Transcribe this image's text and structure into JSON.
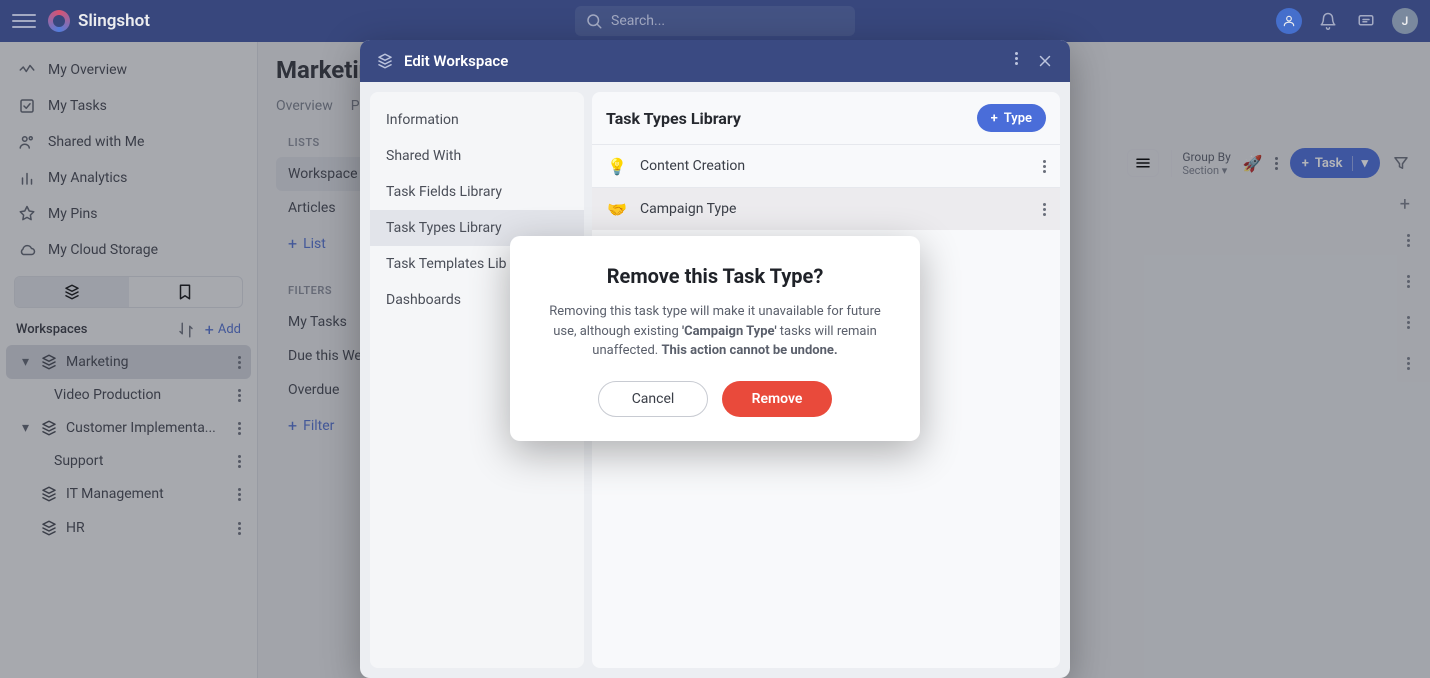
{
  "app": {
    "name": "Slingshot"
  },
  "search": {
    "placeholder": "Search..."
  },
  "top_avatar": "J",
  "sidebar": {
    "items": [
      {
        "label": "My Overview"
      },
      {
        "label": "My Tasks"
      },
      {
        "label": "Shared with Me"
      },
      {
        "label": "My Analytics"
      },
      {
        "label": "My Pins"
      },
      {
        "label": "My Cloud Storage"
      }
    ],
    "workspaces_label": "Workspaces",
    "add_label": "Add",
    "workspaces": [
      {
        "label": "Marketing",
        "selected": true,
        "expandable": true
      },
      {
        "label": "Video Production",
        "sub": true
      },
      {
        "label": "Customer Implementa...",
        "expandable": true
      },
      {
        "label": "Support",
        "sub": true
      },
      {
        "label": "IT Management"
      },
      {
        "label": "HR"
      }
    ]
  },
  "content": {
    "title": "Marketing",
    "tabs": [
      "Overview",
      "P"
    ],
    "lists_label": "LISTS",
    "lists": [
      "Workspace T",
      "Articles"
    ],
    "add_list": "List",
    "filters_label": "FILTERS",
    "filters": [
      "My Tasks",
      "Due this We",
      "Overdue"
    ],
    "add_filter": "Filter"
  },
  "toolbar": {
    "groupby_label": "Group By",
    "groupby_value": "Section",
    "task_label": "Task"
  },
  "modal": {
    "title": "Edit Workspace",
    "sidebar": [
      "Information",
      "Shared With",
      "Task Fields Library",
      "Task Types Library",
      "Task Templates Lib",
      "Dashboards"
    ],
    "selected_index": 3,
    "main_title": "Task Types Library",
    "type_btn": "Type",
    "task_types": [
      {
        "icon": "💡",
        "label": "Content Creation"
      },
      {
        "icon": "🤝",
        "label": "Campaign Type"
      }
    ]
  },
  "confirm": {
    "title": "Remove this Task Type?",
    "body_1": "Removing this task type will make it unavailable for future use, although existing ",
    "body_bold_1": "'Campaign Type'",
    "body_2": " tasks will remain unaffected. ",
    "body_bold_2": "This action cannot be undone.",
    "cancel": "Cancel",
    "remove": "Remove"
  }
}
